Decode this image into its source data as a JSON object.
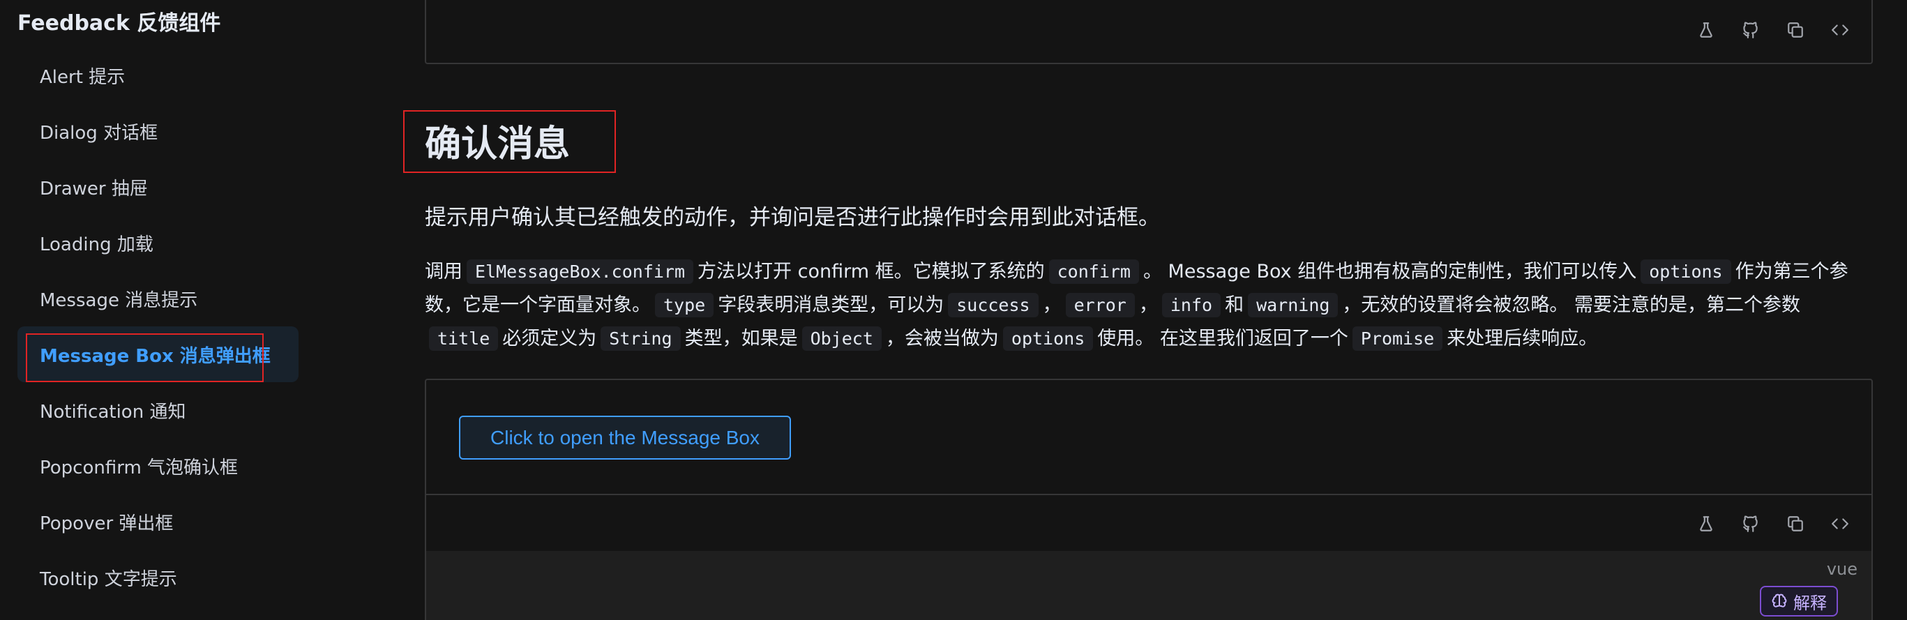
{
  "sidebar": {
    "group_title": "Feedback 反馈组件",
    "items": [
      {
        "label": "Alert 提示"
      },
      {
        "label": "Dialog 对话框"
      },
      {
        "label": "Drawer 抽屉"
      },
      {
        "label": "Loading 加载"
      },
      {
        "label": "Message 消息提示"
      },
      {
        "label": "Message Box 消息弹出框",
        "active": true
      },
      {
        "label": "Notification 通知"
      },
      {
        "label": "Popconfirm 气泡确认框"
      },
      {
        "label": "Popover 弹出框"
      },
      {
        "label": "Tooltip 文字提示"
      }
    ]
  },
  "main": {
    "section_title": "确认消息",
    "lead": "提示用户确认其已经触发的动作，并询问是否进行此操作时会用到此对话框。",
    "para": {
      "t1": "调用",
      "c1": "ElMessageBox.confirm",
      "t2": "方法以打开 confirm 框。它模拟了系统的",
      "c2": "confirm",
      "t3": "。 Message Box 组件也拥有极高的定制性，我们可以传入",
      "c3": "options",
      "t4": "作为第三个参数，它是一个字面量对象。",
      "c4": "type",
      "t5": "字段表明消息类型，可以为",
      "c5": "success",
      "t6": "，",
      "c6": "error",
      "t7": "，",
      "c7": "info",
      "t8": "和",
      "c8": "warning",
      "t9": "，无效的设置将会被忽略。 需要注意的是，第二个参数",
      "c9": "title",
      "t10": "必须定义为",
      "c10": "String",
      "t11": "类型，如果是",
      "c11": "Object",
      "t12": "，会被当做为",
      "c12": "options",
      "t13": "使用。 在这里我们返回了一个",
      "c13": "Promise",
      "t14": "来处理后续响应。"
    },
    "demo": {
      "button_label": "Click to open the Message Box",
      "lang": "vue",
      "explain_label": "解释"
    },
    "toolbar_icons": [
      "playground-icon",
      "github-icon",
      "copy-icon",
      "code-icon"
    ]
  },
  "colors": {
    "accent": "#409eff",
    "background": "#141414",
    "highlight_box": "#e02424"
  }
}
